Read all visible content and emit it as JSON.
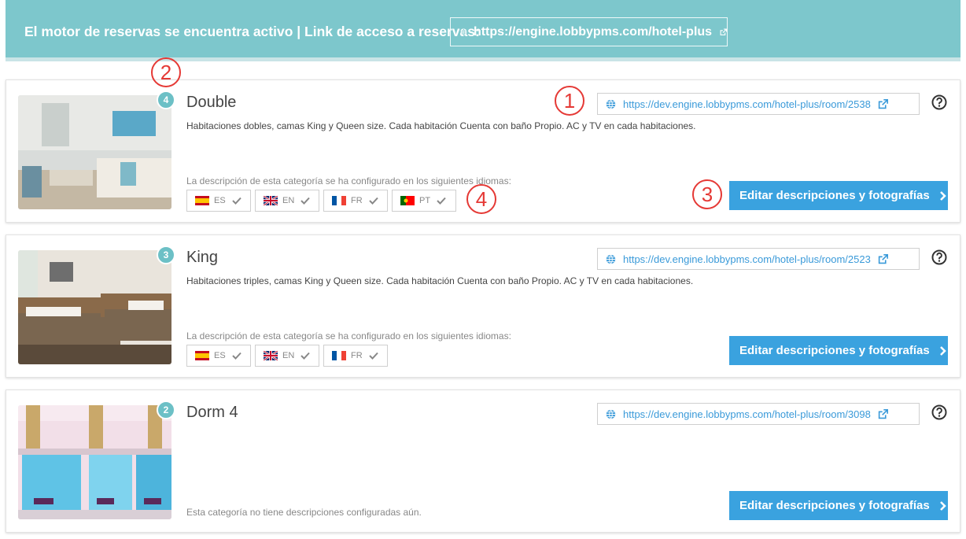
{
  "banner": {
    "text": "El motor de reservas se encuentra activo | Link de acceso a reservas:",
    "link": "https://engine.lobbypms.com/hotel-plus"
  },
  "languages_label": "La descripción de esta categoría se ha configurado en los siguientes idiomas:",
  "edit_button_label": "Editar descripciones y fotografías",
  "rooms": [
    {
      "name": "Double",
      "count": "4",
      "description": "Habitaciones dobles, camas King y Queen size. Cada habitación Cuenta con baño Propio. AC y TV en cada habitaciones.",
      "link": "https://dev.engine.lobbypms.com/hotel-plus/room/2538",
      "languages": [
        "ES",
        "EN",
        "FR",
        "PT"
      ]
    },
    {
      "name": "King",
      "count": "3",
      "description": "Habitaciones triples, camas King y Queen size. Cada habitación Cuenta con baño Propio. AC y TV en cada habitaciones.",
      "link": "https://dev.engine.lobbypms.com/hotel-plus/room/2523",
      "languages": [
        "ES",
        "EN",
        "FR"
      ]
    },
    {
      "name": "Dorm 4",
      "count": "2",
      "no_description": "Esta categoría no tiene descripciones configuradas aún.",
      "link": "https://dev.engine.lobbypms.com/hotel-plus/room/3098"
    }
  ],
  "annotations": [
    "1",
    "2",
    "3",
    "4"
  ],
  "colors": {
    "banner": "#7dc7cc",
    "badge": "#6cc0c6",
    "button": "#3aa2df",
    "link": "#3a9ad9",
    "annotation": "#e53935"
  }
}
